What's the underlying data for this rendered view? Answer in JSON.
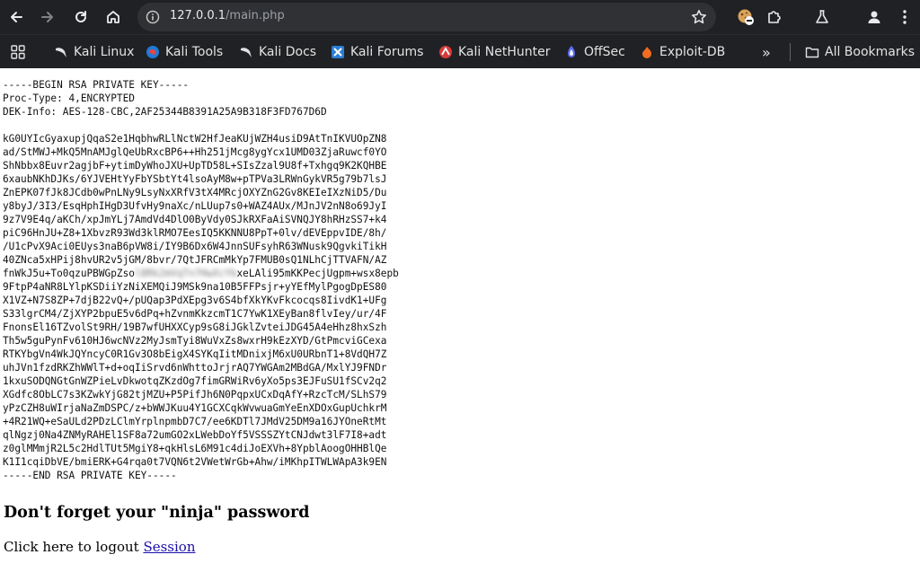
{
  "browser": {
    "url_host": "127.0.0.1",
    "url_path": "/main.php"
  },
  "bookmarks": {
    "items": [
      "Kali Linux",
      "Kali Tools",
      "Kali Docs",
      "Kali Forums",
      "Kali NetHunter",
      "OffSec",
      "Exploit-DB"
    ],
    "more": "»",
    "all_bookmarks": "All Bookmarks"
  },
  "page": {
    "header_lines": [
      "-----BEGIN RSA PRIVATE KEY-----",
      "Proc-Type: 4,ENCRYPTED",
      "DEK-Info: AES-128-CBC,2AF25344B8391A25A9B318F3FD767D6D"
    ],
    "key_lines": [
      "kG0UYIcGyaxupjQqaS2e1HqbhwRLlNctW2HfJeaKUjWZH4usiD9AtTnIKVUOpZN8",
      "ad/StMWJ+MkQ5MnAMJglQeUbRxcBP6++Hh251jMcg8ygYcx1UMD03ZjaRuwcf0YO",
      "ShNbbx8Euvr2agjbF+ytimDyWhoJXU+UpTD58L+SIsZzal9U8f+Txhgq9K2KQHBE",
      "6xaubNKhDJKs/6YJVEHtYyFbYSbtYt4lsoAyM8w+pTPVa3LRWnGykVR5g79b7lsJ",
      "ZnEPK07fJk8JCdb0wPnLNy9LsyNxXRfV3tX4MRcjOXYZnG2Gv8KEIeIXzNiD5/Du",
      "y8byJ/3I3/EsqHphIHgD3UfvHy9naXc/nLUup7s0+WAZ4AUx/MJnJV2nN8o69JyI",
      "9z7V9E4q/aKCh/xpJmYLj7AmdVd4DlO0ByVdy0SJkRXFaAiSVNQJY8hRHzSS7+k4",
      "piC96HnJU+Z8+1XbvzR93Wd3klRMO7EesIQ5KKNNU8PpT+0lv/dEVEppvIDE/8h/",
      "/U1cPvX9Aci0EUys3naB6pVW8i/IY9B6Dx6W4JnnSUFsyhR63WNusk9QgvkiTikH",
      "40ZNca5xHPij8hvUR2v5jGM/8bvr/7QtJFRCmMkYp7FMUB0sQ1NLhCjTTVAFN/AZ"
    ],
    "redacted_line_start": "fnWkJ5u+To0qzuPBWGpZso",
    "redacted_fragment": "l8Rk2mVqTn7HwXcYb",
    "redacted_line_end": "xeLAli95mKKPecjUgpm+wsx8epb",
    "key_lines_after": [
      "9FtpP4aNR8LYlpKSDiiYzNiXEMQiJ9MSk9na10B5FFPsjr+yYEfMylPgogDpES80",
      "X1VZ+N7S8ZP+7djB22vQ+/pUQap3PdXEpg3v6S4bfXkYKvFkcocqs8IivdK1+UFg",
      "S33lgrCM4/ZjXYP2bpuE5v6dPq+hZvnmKkzcmT1C7YwK1XEyBan8flvIey/ur/4F",
      "FnonsEl16TZvolSt9RH/19B7wfUHXXCyp9sG8iJGklZvteiJDG45A4eHhz8hxSzh",
      "Th5w5guPynFv610HJ6wcNVz2MyJsmTyi8WuVxZs8wxrH9kEzXYD/GtPmcviGCexa",
      "RTKYbgVn4WkJQYncyC0R1Gv3O8bEigX4SYKqIitMDnixjM6xU0URbnT1+8VdQH7Z",
      "uhJVn1fzdRKZhWWlT+d+oqIiSrvd6nWhttoJrjrAQ7YWGAm2MBdGA/MxlYJ9FNDr",
      "1kxuSODQNGtGnWZPieLvDkwotqZKzdOg7fimGRWiRv6yXo5ps3EJFuSU1fSCv2q2",
      "XGdfc8ObLC7s3KZwkYjG82tjMZU+P5PifJh6N0PqpxUCxDqAfY+RzcTcM/SLhS79",
      "yPzCZH8uWIrjaNaZmDSPC/z+bWWJKuu4Y1GCXCqkWvwuaGmYeEnXDOxGupUchkrM",
      "+4R21WQ+eSaULd2PDzLClmYrplnpmbD7C7/ee6KDTl7JMdV25DM9a16JYOneRtMt",
      "qlNgzj0Na4ZNMyRAHEl1SF8a72umGO2xLWebDoYf5VSSSZYtCNJdwt3lF7I8+adt",
      "z0glMMmjR2L5c2HdlTUt5MgiY8+qkHlsL6M91c4diJoEXVh+8YpblAoogOHHBlQe",
      "K1I1cqiDbVE/bmiERK+G4rqa0t7VQN6t2VWetWrGb+Ahw/iMKhpITWLWApA3k9EN"
    ],
    "footer_line": "-----END RSA PRIVATE KEY-----",
    "notice": "Don't forget your \"ninja\" password",
    "logout_text": "Click here to logout ",
    "logout_link": "Session"
  },
  "colors": {
    "chrome_bg": "#202124",
    "omnibox_bg": "#303134",
    "link": "#1a0dab"
  }
}
